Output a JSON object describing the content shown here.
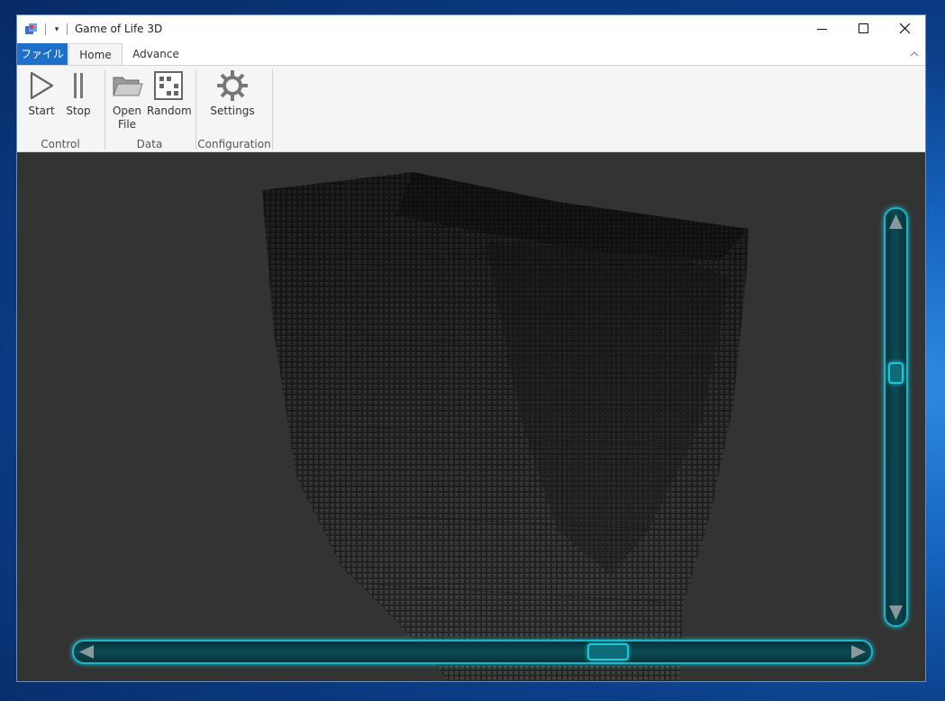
{
  "window": {
    "title": "Game of Life 3D"
  },
  "tabs": {
    "file": "ファイル",
    "home": "Home",
    "advance": "Advance"
  },
  "ribbon": {
    "control": {
      "label": "Control",
      "start": "Start",
      "stop": "Stop"
    },
    "data": {
      "label": "Data",
      "open_line1": "Open",
      "open_line2": "File",
      "random": "Random"
    },
    "configuration": {
      "label": "Configuration",
      "settings": "Settings"
    }
  },
  "icons": {
    "app": "app-icon",
    "minimize": "minimize-icon",
    "maximize": "maximize-icon",
    "close": "close-icon",
    "start": "play-icon",
    "stop": "pause-icon",
    "open": "folder-icon",
    "random": "grid-icon",
    "settings": "gear-icon"
  },
  "colors": {
    "file_tab": "#1e6fc9",
    "viewport_bg": "#333333",
    "scroll_accent": "#17b7c9"
  },
  "scroll": {
    "vertical_position": 0.37,
    "horizontal_position": 0.67
  }
}
